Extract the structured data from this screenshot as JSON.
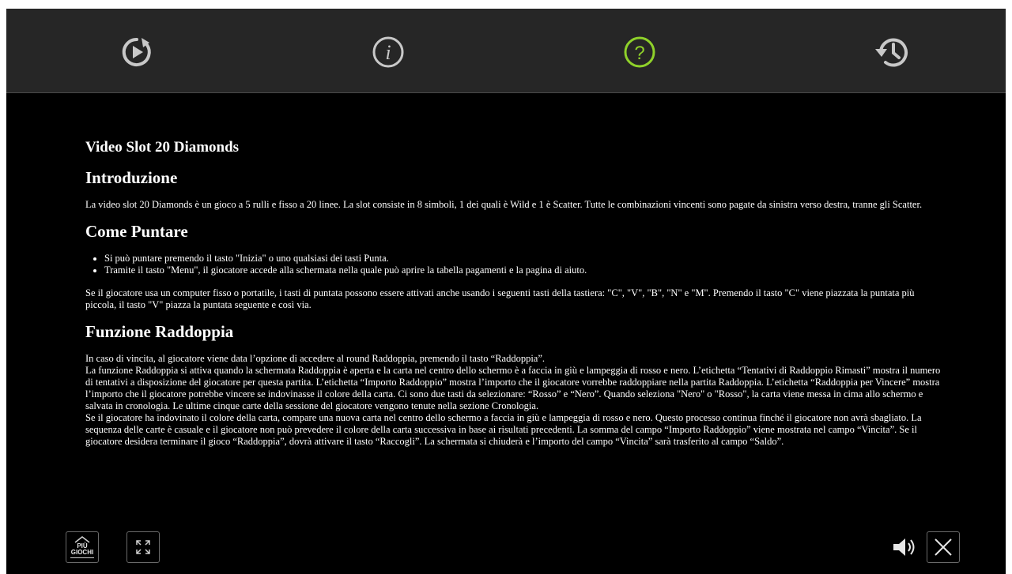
{
  "colors": {
    "topbar_bg": "#262626",
    "icon": "#c8c8c8",
    "help_active": "#8fd12a",
    "text": "#ffffff",
    "background": "#000000"
  },
  "toolbar": {
    "icons": [
      "play-replay-icon",
      "info-icon",
      "help-icon",
      "history-icon"
    ],
    "active": "help-icon"
  },
  "help_char": "?",
  "info_char": "i",
  "content": {
    "title": "Video Slot 20 Diamonds",
    "intro": {
      "heading": "Introduzione",
      "text": "La video slot 20 Diamonds è un gioco a 5 rulli e fisso a 20 linee. La slot consiste in 8 simboli, 1 dei quali è Wild e 1 è Scatter. Tutte le combinazioni vincenti sono pagate da sinistra verso destra, tranne gli Scatter."
    },
    "bet": {
      "heading": "Come Puntare",
      "items": [
        "Si può puntare premendo il tasto \"Inizia\" o uno qualsiasi dei tasti Punta.",
        "Tramite il tasto \"Menu\", il giocatore accede alla schermata nella quale può aprire la tabella pagamenti e la pagina di aiuto."
      ],
      "text": "Se il giocatore usa un computer fisso o portatile, i tasti di puntata possono essere attivati anche usando i seguenti tasti della tastiera: \"C\", \"V\", \"B\", \"N\" e \"M\". Premendo il tasto \"C\" viene piazzata la puntata più piccola, il tasto \"V\" piazza la puntata seguente e così via."
    },
    "double": {
      "heading": "Funzione Raddoppia",
      "p1": "In caso di vincita, al giocatore viene data l’opzione di accedere al round Raddoppia, premendo il tasto “Raddoppia”.",
      "p2": "La funzione Raddoppia si attiva quando la schermata Raddoppia è aperta e la carta nel centro dello schermo è a faccia in giù e lampeggia di rosso e nero. L’etichetta “Tentativi di Raddoppio Rimasti” mostra il numero di tentativi a disposizione del giocatore per questa partita. L’etichetta “Importo Raddoppio” mostra l’importo che il giocatore vorrebbe raddoppiare nella partita Raddoppia. L’etichetta “Raddoppia per Vincere” mostra l’importo che il giocatore potrebbe vincere se indovinasse il colore della carta. Ci sono due tasti da selezionare: “Rosso” e “Nero”. Quando seleziona \"Nero\" o \"Rosso\", la carta viene messa in cima allo schermo e salvata in cronologia. Le ultime cinque carte della sessione del giocatore vengono tenute nella sezione Cronologia.",
      "p3": "Se il giocatore ha indovinato il colore della carta, compare una nuova carta nel centro dello schermo a faccia in giù e lampeggia di rosso e nero. Questo processo continua finché il giocatore non avrà sbagliato. La sequenza delle carte è casuale e il giocatore non può prevedere il colore della carta successiva in base ai risultati precedenti. La somma del campo “Importo Raddoppio” viene mostrata nel campo “Vincita”. Se il giocatore desidera terminare il gioco “Raddoppia”, dovrà attivare il tasto “Raccogli”. La schermata si chiuderà e l’importo del campo “Vincita” sarà trasferito al campo “Saldo”."
    }
  },
  "bottom": {
    "more_games_line1": "PIÙ",
    "more_games_line2": "GIOCHI",
    "icons": [
      "house-icon",
      "fullscreen-icon",
      "sound-icon",
      "close-icon"
    ]
  }
}
